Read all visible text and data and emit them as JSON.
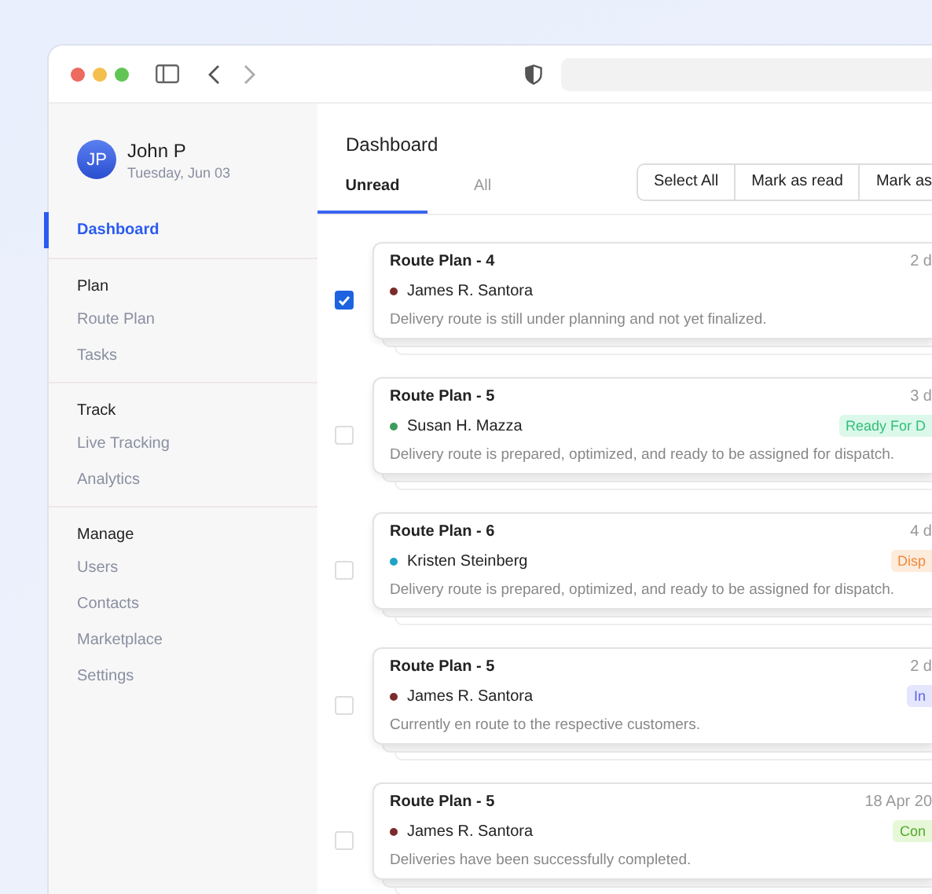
{
  "user": {
    "initials": "JP",
    "name": "John P",
    "date": "Tuesday, Jun 03"
  },
  "sidebar": {
    "sections": [
      {
        "items": [
          {
            "label": "Dashboard",
            "selected": true
          }
        ]
      },
      {
        "heading": "Plan",
        "items": [
          {
            "label": "Route Plan",
            "selected": false
          },
          {
            "label": "Tasks",
            "selected": false
          }
        ]
      },
      {
        "heading": "Track",
        "items": [
          {
            "label": "Live Tracking",
            "selected": false
          },
          {
            "label": "Analytics",
            "selected": false
          }
        ]
      },
      {
        "heading": "Manage",
        "items": [
          {
            "label": "Users",
            "selected": false
          },
          {
            "label": "Contacts",
            "selected": false
          },
          {
            "label": "Marketplace",
            "selected": false
          },
          {
            "label": "Settings",
            "selected": false
          }
        ]
      }
    ]
  },
  "page_title": "Dashboard",
  "tabs": [
    {
      "label": "Unread",
      "selected": true
    },
    {
      "label": "All",
      "selected": false
    }
  ],
  "actions": [
    "Select All",
    "Mark as read",
    "Mark as"
  ],
  "cards": [
    {
      "title": "Route Plan - 4",
      "time": "2 d",
      "person": "James R. Santora",
      "color": "#7b2b2b",
      "text": "Delivery route is still under planning and not yet finalized.",
      "checked": true
    },
    {
      "title": "Route Plan - 5",
      "time": "3 d",
      "person": "Susan H. Mazza",
      "color": "#3f9a5e",
      "status": {
        "text": "Ready For D",
        "kind": "ready"
      },
      "text": "Delivery route is prepared, optimized, and ready to be assigned for dispatch.",
      "checked": false
    },
    {
      "title": "Route Plan - 6",
      "time": "4 d",
      "person": "Kristen Steinberg",
      "color": "#1ea3c4",
      "status": {
        "text": "Disp",
        "kind": "dispatch"
      },
      "text": "Delivery route is prepared, optimized, and ready to be assigned for dispatch.",
      "checked": false
    },
    {
      "title": "Route Plan - 5",
      "time": "2 d",
      "person": "James R. Santora",
      "color": "#7b2b2b",
      "status": {
        "text": "In",
        "kind": "transit"
      },
      "text": "Currently en route to the respective customers.",
      "checked": false
    },
    {
      "title": "Route Plan - 5",
      "time": "18 Apr 20",
      "person": "James R. Santora",
      "color": "#7b2b2b",
      "status": {
        "text": "Con",
        "kind": "done"
      },
      "text": "Deliveries have been successfully completed.",
      "checked": false
    }
  ]
}
